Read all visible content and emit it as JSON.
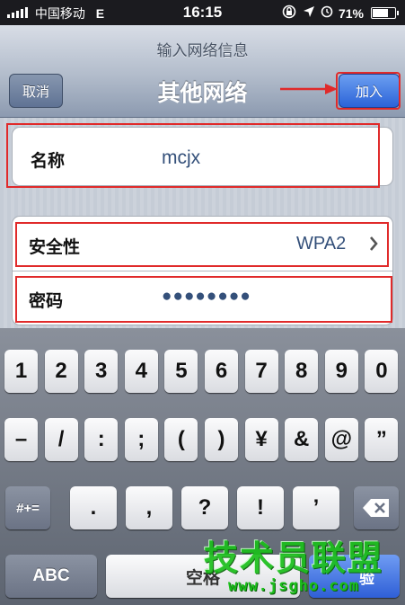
{
  "status_bar": {
    "carrier": "中国移动",
    "network": "E",
    "time": "16:15",
    "battery": "71%",
    "battery_level": 0.71
  },
  "nav": {
    "prompt": "输入网络信息",
    "title": "其他网络",
    "cancel_label": "取消",
    "join_label": "加入"
  },
  "form": {
    "name_label": "名称",
    "name_value": "mcjx",
    "security_label": "安全性",
    "security_value": "WPA2",
    "password_label": "密码",
    "password_value": "●●●●●●●●"
  },
  "keyboard": {
    "row1": [
      "1",
      "2",
      "3",
      "4",
      "5",
      "6",
      "7",
      "8",
      "9",
      "0"
    ],
    "row2": [
      "–",
      "/",
      ":",
      ";",
      "(",
      ")",
      "¥",
      "&",
      "@",
      "”"
    ],
    "row3_toggle": "#+=",
    "row3": [
      ".",
      ",",
      "?",
      "!",
      "’"
    ],
    "abc_label": "ABC",
    "space_label": "空格",
    "return_label": "验"
  },
  "watermark": {
    "main": "技术员联盟",
    "url": "www.jsgho.com"
  },
  "colors": {
    "highlight": "#e02a2a",
    "join_button": "#2b63d8",
    "value_text": "#34507a"
  }
}
